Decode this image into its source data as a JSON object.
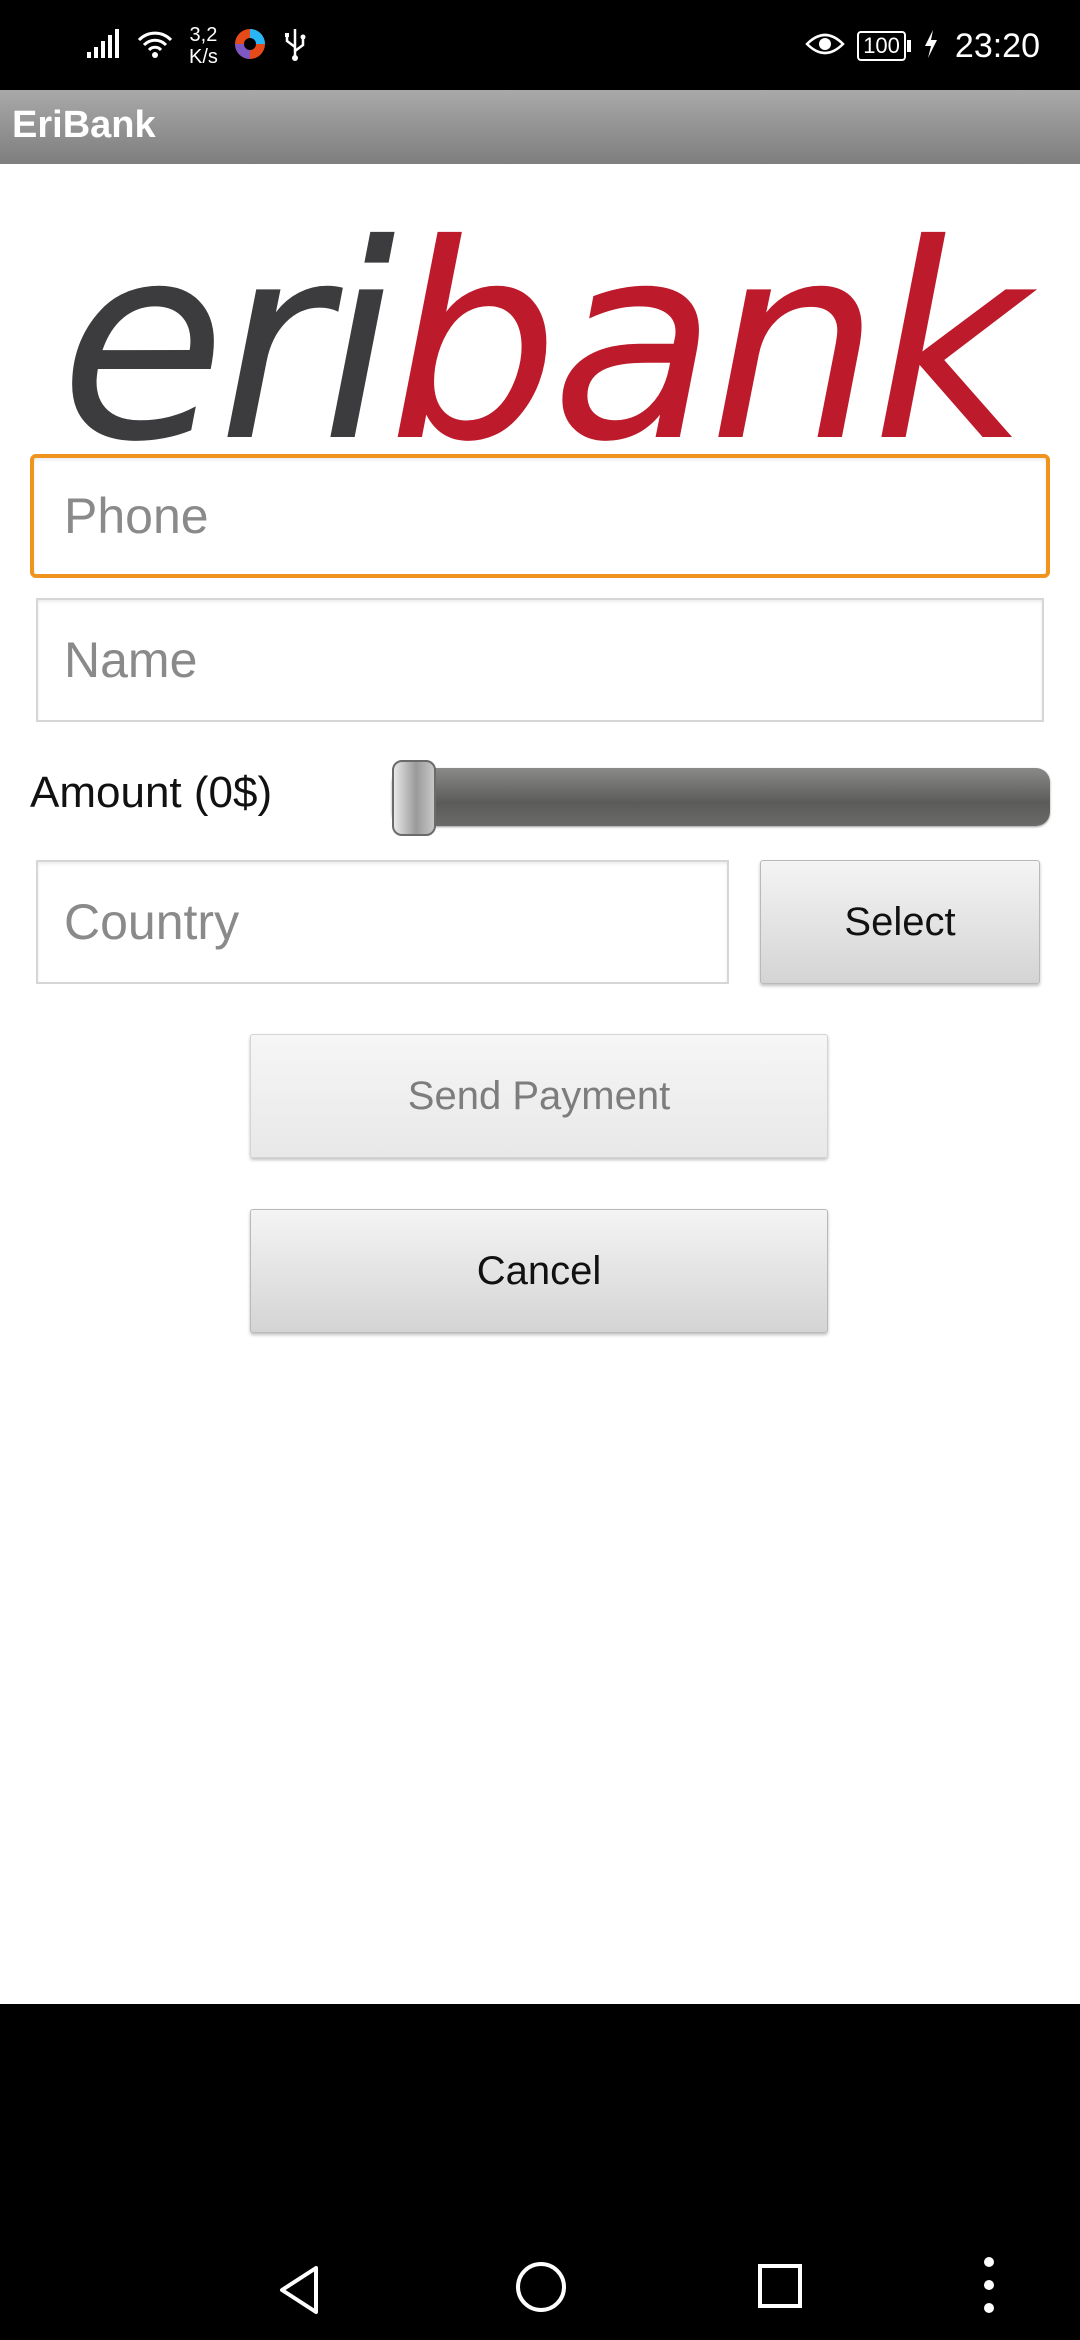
{
  "status_bar": {
    "net_speed_value": "3,2",
    "net_speed_unit": "K/s",
    "battery": "100",
    "time": "23:20"
  },
  "app": {
    "title": "EriBank"
  },
  "logo": {
    "part1": "eri",
    "part2": "bank"
  },
  "form": {
    "phone": {
      "placeholder": "Phone",
      "value": ""
    },
    "name": {
      "placeholder": "Name",
      "value": ""
    },
    "amount": {
      "label": "Amount (0$)",
      "value": 0
    },
    "country": {
      "placeholder": "Country",
      "value": ""
    },
    "select_label": "Select",
    "send_label": "Send Payment",
    "cancel_label": "Cancel"
  },
  "colors": {
    "focus": "#f0941e",
    "logo_dark": "#3c3c3e",
    "logo_red": "#bd1a2b"
  }
}
